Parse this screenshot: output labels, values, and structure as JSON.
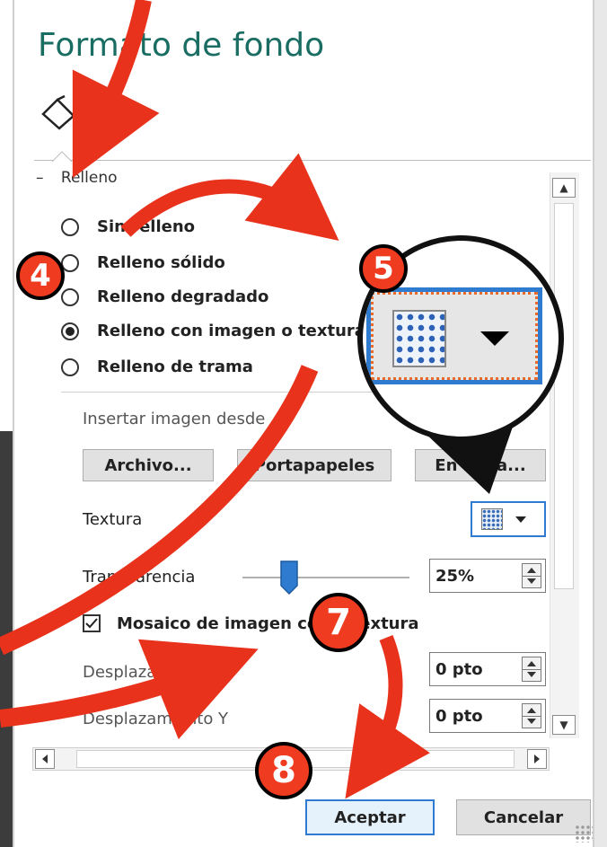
{
  "panel": {
    "title": "Formato de fondo",
    "tab_icon": "paint-bucket-icon",
    "section_header": "Relleno"
  },
  "fill_options": [
    {
      "label": "Sin relleno",
      "selected": false
    },
    {
      "label": "Relleno sólido",
      "selected": false
    },
    {
      "label": "Relleno degradado",
      "selected": false
    },
    {
      "label": "Relleno con imagen o textura",
      "selected": true
    },
    {
      "label": "Relleno de trama",
      "selected": false
    }
  ],
  "insert_image": {
    "label": "Insertar imagen desde",
    "file_button": "Archivo...",
    "clipboard_button": "Portapapeles",
    "online_button": "En línea..."
  },
  "texture": {
    "label": "Textura",
    "picker_icon": "texture-swatch-icon"
  },
  "transparency": {
    "label": "Transparencia",
    "value": "25%",
    "level": 0.25
  },
  "tile_checkbox": {
    "label": "Mosaico de imagen como textura",
    "checked": true
  },
  "offset_x": {
    "label": "Desplazamiento X",
    "value": "0 pto"
  },
  "offset_y": {
    "label": "Desplazamiento Y",
    "value": "0 pto"
  },
  "footer": {
    "ok_button": "Aceptar",
    "cancel_button": "Cancelar"
  },
  "annotations": {
    "step_badges": [
      "4",
      "5",
      "7",
      "8"
    ],
    "arrow_color": "#e8321c",
    "badge_color": "#ef3b1f"
  },
  "colors": {
    "title": "#1a6d62",
    "accent": "#2f7bd0",
    "slider_thumb": "#2f7bd0"
  }
}
